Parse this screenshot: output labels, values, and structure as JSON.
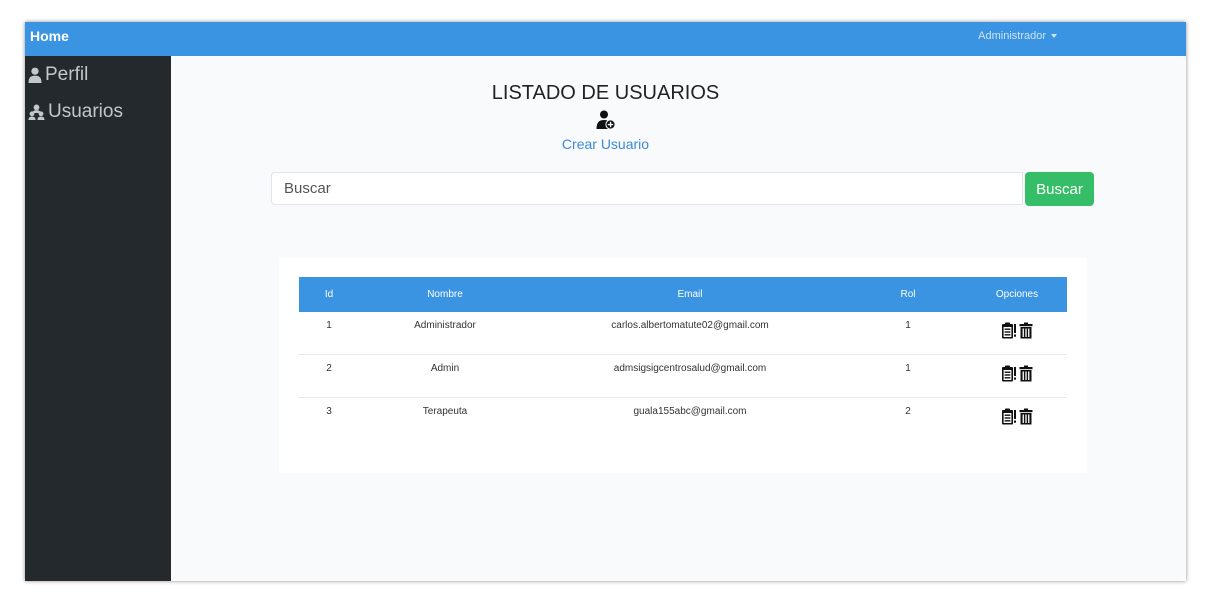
{
  "navbar": {
    "brand": "Home",
    "user_menu": "Administrador"
  },
  "sidebar": {
    "items": [
      {
        "label": "Perfil",
        "icon": "user-icon"
      },
      {
        "label": "Usuarios",
        "icon": "users-icon"
      }
    ]
  },
  "main": {
    "title": "LISTADO DE USUARIOS",
    "create_user_label": "Crear Usuario",
    "create_user_icon": "user-plus-icon"
  },
  "search": {
    "placeholder": "Buscar",
    "button_label": "Buscar"
  },
  "table": {
    "headers": [
      "Id",
      "Nombre",
      "Email",
      "Rol",
      "Opciones"
    ],
    "rows": [
      [
        "1",
        "Administrador",
        "carlos.albertomatute02@gmail.com",
        "1"
      ],
      [
        "2",
        "Admin",
        "admsigsigcentrosalud@gmail.com",
        "1"
      ],
      [
        "3",
        "Terapeuta",
        "guala155abc@gmail.com",
        "2"
      ]
    ],
    "row_option_icons": [
      "edit-clipboard-icon",
      "trash-icon"
    ]
  },
  "colors": {
    "navbar": "#3a94e1",
    "sidebar": "#24292d",
    "accent_link": "#3b8ad6",
    "search_button": "#35be67"
  }
}
